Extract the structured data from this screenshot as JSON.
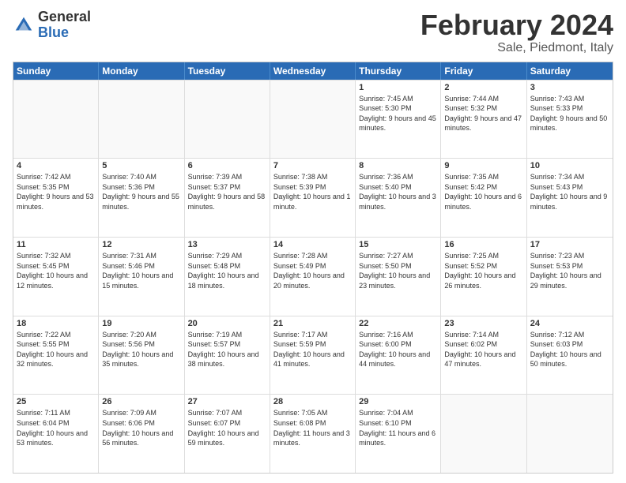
{
  "logo": {
    "general": "General",
    "blue": "Blue"
  },
  "title": {
    "month": "February 2024",
    "location": "Sale, Piedmont, Italy"
  },
  "header": {
    "days": [
      "Sunday",
      "Monday",
      "Tuesday",
      "Wednesday",
      "Thursday",
      "Friday",
      "Saturday"
    ]
  },
  "rows": [
    [
      {
        "day": "",
        "empty": true
      },
      {
        "day": "",
        "empty": true
      },
      {
        "day": "",
        "empty": true
      },
      {
        "day": "",
        "empty": true
      },
      {
        "day": "1",
        "sunrise": "Sunrise: 7:45 AM",
        "sunset": "Sunset: 5:30 PM",
        "daylight": "Daylight: 9 hours and 45 minutes."
      },
      {
        "day": "2",
        "sunrise": "Sunrise: 7:44 AM",
        "sunset": "Sunset: 5:32 PM",
        "daylight": "Daylight: 9 hours and 47 minutes."
      },
      {
        "day": "3",
        "sunrise": "Sunrise: 7:43 AM",
        "sunset": "Sunset: 5:33 PM",
        "daylight": "Daylight: 9 hours and 50 minutes."
      }
    ],
    [
      {
        "day": "4",
        "sunrise": "Sunrise: 7:42 AM",
        "sunset": "Sunset: 5:35 PM",
        "daylight": "Daylight: 9 hours and 53 minutes."
      },
      {
        "day": "5",
        "sunrise": "Sunrise: 7:40 AM",
        "sunset": "Sunset: 5:36 PM",
        "daylight": "Daylight: 9 hours and 55 minutes."
      },
      {
        "day": "6",
        "sunrise": "Sunrise: 7:39 AM",
        "sunset": "Sunset: 5:37 PM",
        "daylight": "Daylight: 9 hours and 58 minutes."
      },
      {
        "day": "7",
        "sunrise": "Sunrise: 7:38 AM",
        "sunset": "Sunset: 5:39 PM",
        "daylight": "Daylight: 10 hours and 1 minute."
      },
      {
        "day": "8",
        "sunrise": "Sunrise: 7:36 AM",
        "sunset": "Sunset: 5:40 PM",
        "daylight": "Daylight: 10 hours and 3 minutes."
      },
      {
        "day": "9",
        "sunrise": "Sunrise: 7:35 AM",
        "sunset": "Sunset: 5:42 PM",
        "daylight": "Daylight: 10 hours and 6 minutes."
      },
      {
        "day": "10",
        "sunrise": "Sunrise: 7:34 AM",
        "sunset": "Sunset: 5:43 PM",
        "daylight": "Daylight: 10 hours and 9 minutes."
      }
    ],
    [
      {
        "day": "11",
        "sunrise": "Sunrise: 7:32 AM",
        "sunset": "Sunset: 5:45 PM",
        "daylight": "Daylight: 10 hours and 12 minutes."
      },
      {
        "day": "12",
        "sunrise": "Sunrise: 7:31 AM",
        "sunset": "Sunset: 5:46 PM",
        "daylight": "Daylight: 10 hours and 15 minutes."
      },
      {
        "day": "13",
        "sunrise": "Sunrise: 7:29 AM",
        "sunset": "Sunset: 5:48 PM",
        "daylight": "Daylight: 10 hours and 18 minutes."
      },
      {
        "day": "14",
        "sunrise": "Sunrise: 7:28 AM",
        "sunset": "Sunset: 5:49 PM",
        "daylight": "Daylight: 10 hours and 20 minutes."
      },
      {
        "day": "15",
        "sunrise": "Sunrise: 7:27 AM",
        "sunset": "Sunset: 5:50 PM",
        "daylight": "Daylight: 10 hours and 23 minutes."
      },
      {
        "day": "16",
        "sunrise": "Sunrise: 7:25 AM",
        "sunset": "Sunset: 5:52 PM",
        "daylight": "Daylight: 10 hours and 26 minutes."
      },
      {
        "day": "17",
        "sunrise": "Sunrise: 7:23 AM",
        "sunset": "Sunset: 5:53 PM",
        "daylight": "Daylight: 10 hours and 29 minutes."
      }
    ],
    [
      {
        "day": "18",
        "sunrise": "Sunrise: 7:22 AM",
        "sunset": "Sunset: 5:55 PM",
        "daylight": "Daylight: 10 hours and 32 minutes."
      },
      {
        "day": "19",
        "sunrise": "Sunrise: 7:20 AM",
        "sunset": "Sunset: 5:56 PM",
        "daylight": "Daylight: 10 hours and 35 minutes."
      },
      {
        "day": "20",
        "sunrise": "Sunrise: 7:19 AM",
        "sunset": "Sunset: 5:57 PM",
        "daylight": "Daylight: 10 hours and 38 minutes."
      },
      {
        "day": "21",
        "sunrise": "Sunrise: 7:17 AM",
        "sunset": "Sunset: 5:59 PM",
        "daylight": "Daylight: 10 hours and 41 minutes."
      },
      {
        "day": "22",
        "sunrise": "Sunrise: 7:16 AM",
        "sunset": "Sunset: 6:00 PM",
        "daylight": "Daylight: 10 hours and 44 minutes."
      },
      {
        "day": "23",
        "sunrise": "Sunrise: 7:14 AM",
        "sunset": "Sunset: 6:02 PM",
        "daylight": "Daylight: 10 hours and 47 minutes."
      },
      {
        "day": "24",
        "sunrise": "Sunrise: 7:12 AM",
        "sunset": "Sunset: 6:03 PM",
        "daylight": "Daylight: 10 hours and 50 minutes."
      }
    ],
    [
      {
        "day": "25",
        "sunrise": "Sunrise: 7:11 AM",
        "sunset": "Sunset: 6:04 PM",
        "daylight": "Daylight: 10 hours and 53 minutes."
      },
      {
        "day": "26",
        "sunrise": "Sunrise: 7:09 AM",
        "sunset": "Sunset: 6:06 PM",
        "daylight": "Daylight: 10 hours and 56 minutes."
      },
      {
        "day": "27",
        "sunrise": "Sunrise: 7:07 AM",
        "sunset": "Sunset: 6:07 PM",
        "daylight": "Daylight: 10 hours and 59 minutes."
      },
      {
        "day": "28",
        "sunrise": "Sunrise: 7:05 AM",
        "sunset": "Sunset: 6:08 PM",
        "daylight": "Daylight: 11 hours and 3 minutes."
      },
      {
        "day": "29",
        "sunrise": "Sunrise: 7:04 AM",
        "sunset": "Sunset: 6:10 PM",
        "daylight": "Daylight: 11 hours and 6 minutes."
      },
      {
        "day": "",
        "empty": true
      },
      {
        "day": "",
        "empty": true
      }
    ]
  ]
}
